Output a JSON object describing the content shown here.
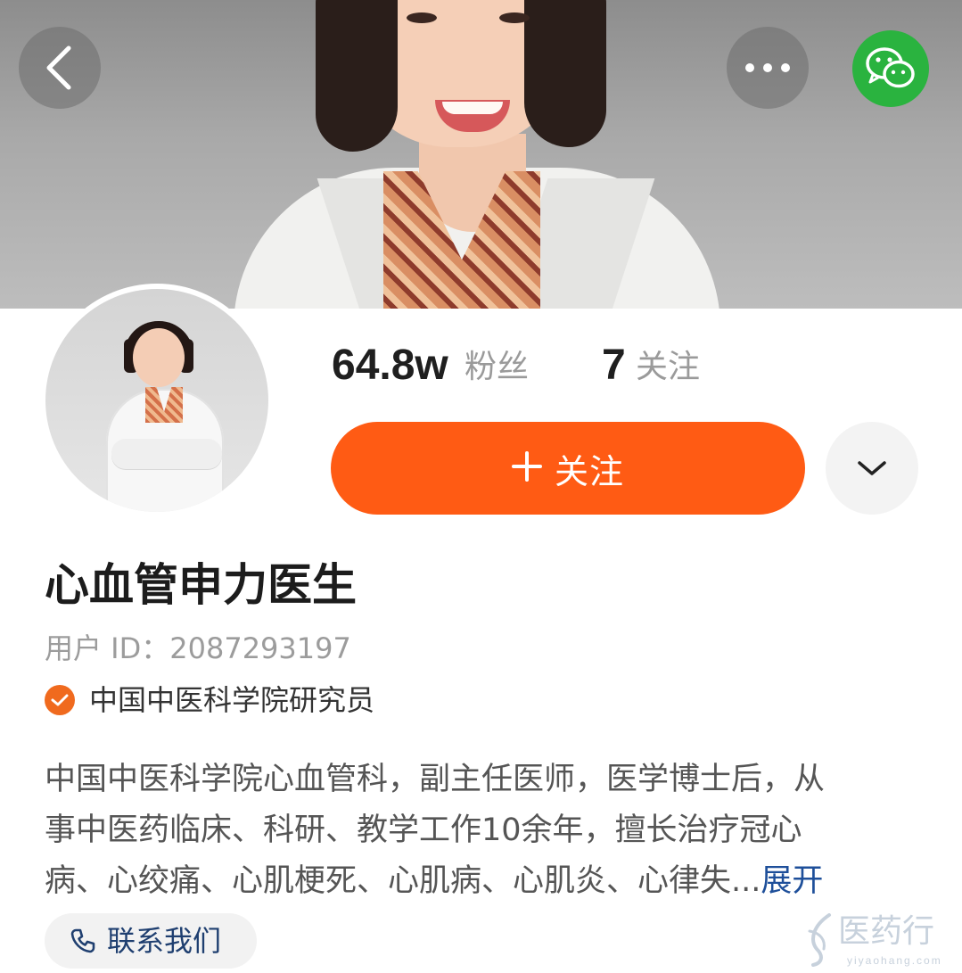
{
  "colors": {
    "accent": "#ff5b14",
    "wechat_green": "#2ab33f",
    "verify_orange": "#f06a1e",
    "link_blue": "#1e4f9a"
  },
  "header": {
    "back_icon": "chevron-left-icon",
    "more_icon": "ellipsis-icon",
    "share_icon": "wechat-icon"
  },
  "stats": {
    "followers_value": "64.8w",
    "followers_label": "粉丝",
    "following_value": "7",
    "following_label": "关注"
  },
  "actions": {
    "follow_label": "关注",
    "follow_icon": "plus-icon",
    "dropdown_icon": "chevron-down-icon"
  },
  "profile": {
    "name": "心血管申力医生",
    "user_id": "用户 ID：2087293197",
    "verified_text": "中国中医科学院研究员",
    "bio_lines": [
      "中国中医科学院心血管科，副主任医师，医学博士后，从",
      "事中医药临床、科研、教学工作10余年，擅长治疗冠心",
      "病、心绞痛、心肌梗死、心肌病、心肌炎、心律失..."
    ],
    "expand_label": "展开",
    "contact_label": "联系我们"
  },
  "watermark": {
    "text": "医药行",
    "sub": "yiyaohang.com"
  }
}
